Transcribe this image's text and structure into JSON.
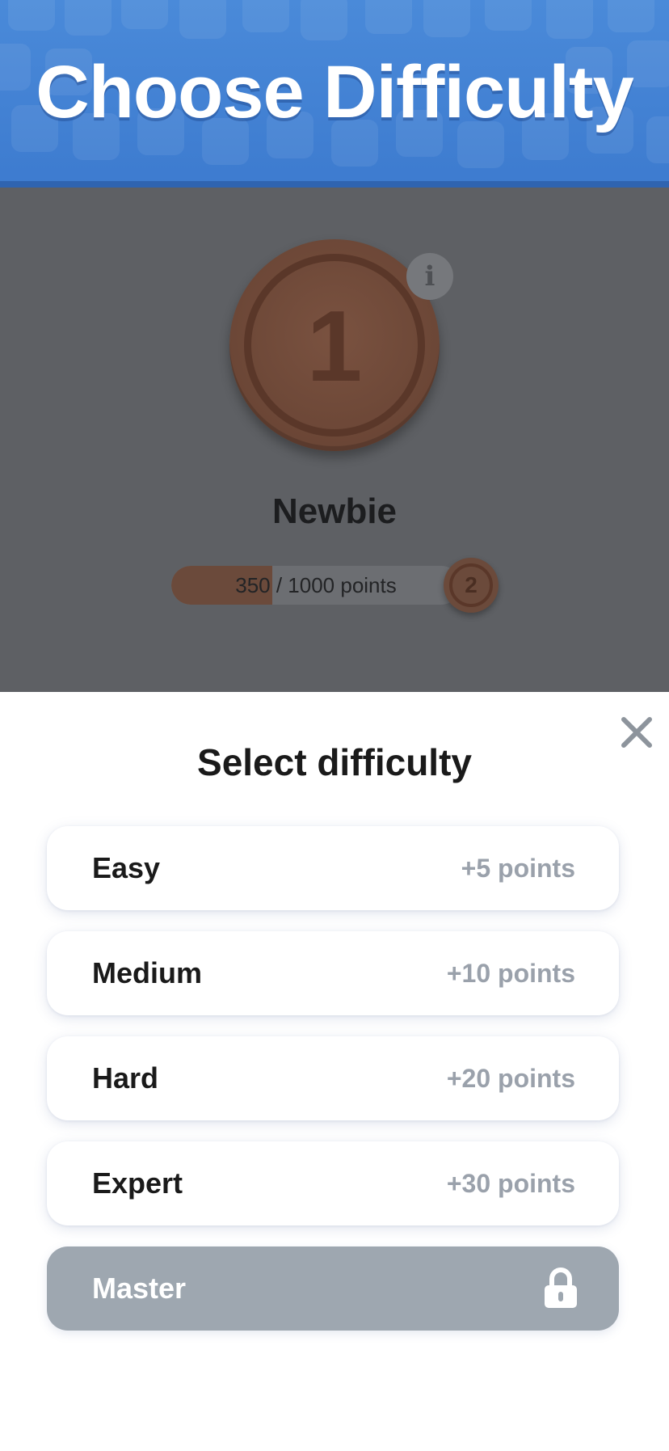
{
  "header": {
    "title": "Choose Difficulty"
  },
  "level": {
    "current_level": "1",
    "rank_name": "Newbie",
    "progress_text": "350 / 1000 points",
    "progress_fraction": 0.35,
    "next_level": "2",
    "info_icon": "i"
  },
  "sheet": {
    "title": "Select difficulty",
    "close_icon": "close-icon",
    "options": [
      {
        "label": "Easy",
        "points": "+5 points",
        "locked": false
      },
      {
        "label": "Medium",
        "points": "+10 points",
        "locked": false
      },
      {
        "label": "Hard",
        "points": "+20 points",
        "locked": false
      },
      {
        "label": "Expert",
        "points": "+30 points",
        "locked": false
      },
      {
        "label": "Master",
        "points": "",
        "locked": true,
        "icon": "lock-icon"
      }
    ]
  },
  "colors": {
    "header_blue": "#4a8ad9",
    "bronze": "#6b4a3b",
    "locked_gray": "#9ea7b0",
    "points_gray": "#9aa1ab"
  }
}
